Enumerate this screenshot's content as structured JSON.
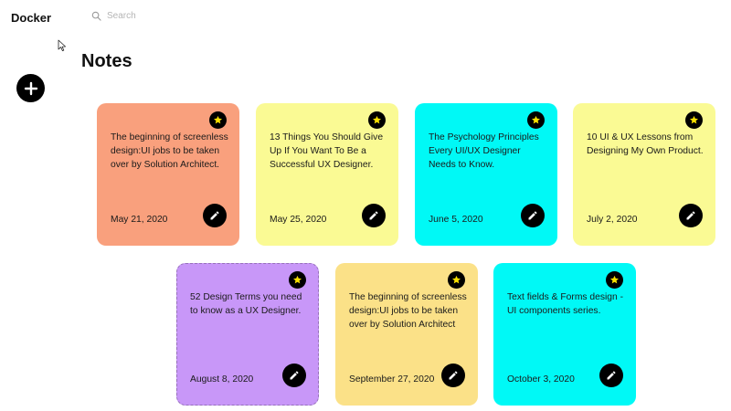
{
  "app": {
    "brand": "Docker"
  },
  "search": {
    "placeholder": "Search"
  },
  "page": {
    "title": "Notes"
  },
  "notes": [
    {
      "text": "The beginning of screenless design:UI jobs to be taken over by Solution Architect.",
      "date": "May 21, 2020",
      "color": "#f9a07d"
    },
    {
      "text": "13 Things You Should Give Up If You Want To Be a Successful UX Designer.",
      "date": "May 25, 2020",
      "color": "#fafa94"
    },
    {
      "text": "The Psychology Principles Every UI/UX Designer Needs to Know.",
      "date": "June 5, 2020",
      "color": "#00f9f6"
    },
    {
      "text": "10 UI & UX Lessons from Designing My Own Product.",
      "date": "July 2, 2020",
      "color": "#fafa94"
    },
    {
      "text": "52 Design Terms you need to know as a UX Designer.",
      "date": "August 8, 2020",
      "color": "#c897f8"
    },
    {
      "text": "The beginning of screenless design:UI jobs to be taken over by Solution Architect",
      "date": "September 27, 2020",
      "color": "#fbe188"
    },
    {
      "text": "Text fields & Forms design - UI components series.",
      "date": "October 3, 2020",
      "color": "#00f9f6"
    }
  ],
  "icons": {
    "star_color": "#f6e000"
  }
}
